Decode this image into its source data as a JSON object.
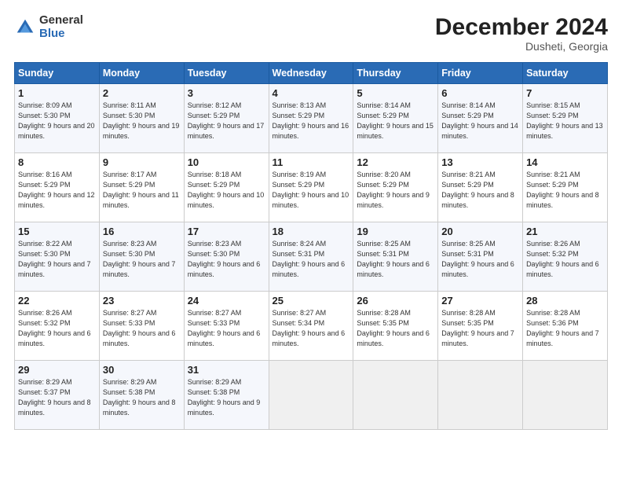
{
  "header": {
    "logo_general": "General",
    "logo_blue": "Blue",
    "month_title": "December 2024",
    "location": "Dusheti, Georgia"
  },
  "days_of_week": [
    "Sunday",
    "Monday",
    "Tuesday",
    "Wednesday",
    "Thursday",
    "Friday",
    "Saturday"
  ],
  "weeks": [
    [
      {
        "day": "1",
        "sunrise": "Sunrise: 8:09 AM",
        "sunset": "Sunset: 5:30 PM",
        "daylight": "Daylight: 9 hours and 20 minutes."
      },
      {
        "day": "2",
        "sunrise": "Sunrise: 8:11 AM",
        "sunset": "Sunset: 5:30 PM",
        "daylight": "Daylight: 9 hours and 19 minutes."
      },
      {
        "day": "3",
        "sunrise": "Sunrise: 8:12 AM",
        "sunset": "Sunset: 5:29 PM",
        "daylight": "Daylight: 9 hours and 17 minutes."
      },
      {
        "day": "4",
        "sunrise": "Sunrise: 8:13 AM",
        "sunset": "Sunset: 5:29 PM",
        "daylight": "Daylight: 9 hours and 16 minutes."
      },
      {
        "day": "5",
        "sunrise": "Sunrise: 8:14 AM",
        "sunset": "Sunset: 5:29 PM",
        "daylight": "Daylight: 9 hours and 15 minutes."
      },
      {
        "day": "6",
        "sunrise": "Sunrise: 8:14 AM",
        "sunset": "Sunset: 5:29 PM",
        "daylight": "Daylight: 9 hours and 14 minutes."
      },
      {
        "day": "7",
        "sunrise": "Sunrise: 8:15 AM",
        "sunset": "Sunset: 5:29 PM",
        "daylight": "Daylight: 9 hours and 13 minutes."
      }
    ],
    [
      {
        "day": "8",
        "sunrise": "Sunrise: 8:16 AM",
        "sunset": "Sunset: 5:29 PM",
        "daylight": "Daylight: 9 hours and 12 minutes."
      },
      {
        "day": "9",
        "sunrise": "Sunrise: 8:17 AM",
        "sunset": "Sunset: 5:29 PM",
        "daylight": "Daylight: 9 hours and 11 minutes."
      },
      {
        "day": "10",
        "sunrise": "Sunrise: 8:18 AM",
        "sunset": "Sunset: 5:29 PM",
        "daylight": "Daylight: 9 hours and 10 minutes."
      },
      {
        "day": "11",
        "sunrise": "Sunrise: 8:19 AM",
        "sunset": "Sunset: 5:29 PM",
        "daylight": "Daylight: 9 hours and 10 minutes."
      },
      {
        "day": "12",
        "sunrise": "Sunrise: 8:20 AM",
        "sunset": "Sunset: 5:29 PM",
        "daylight": "Daylight: 9 hours and 9 minutes."
      },
      {
        "day": "13",
        "sunrise": "Sunrise: 8:21 AM",
        "sunset": "Sunset: 5:29 PM",
        "daylight": "Daylight: 9 hours and 8 minutes."
      },
      {
        "day": "14",
        "sunrise": "Sunrise: 8:21 AM",
        "sunset": "Sunset: 5:29 PM",
        "daylight": "Daylight: 9 hours and 8 minutes."
      }
    ],
    [
      {
        "day": "15",
        "sunrise": "Sunrise: 8:22 AM",
        "sunset": "Sunset: 5:30 PM",
        "daylight": "Daylight: 9 hours and 7 minutes."
      },
      {
        "day": "16",
        "sunrise": "Sunrise: 8:23 AM",
        "sunset": "Sunset: 5:30 PM",
        "daylight": "Daylight: 9 hours and 7 minutes."
      },
      {
        "day": "17",
        "sunrise": "Sunrise: 8:23 AM",
        "sunset": "Sunset: 5:30 PM",
        "daylight": "Daylight: 9 hours and 6 minutes."
      },
      {
        "day": "18",
        "sunrise": "Sunrise: 8:24 AM",
        "sunset": "Sunset: 5:31 PM",
        "daylight": "Daylight: 9 hours and 6 minutes."
      },
      {
        "day": "19",
        "sunrise": "Sunrise: 8:25 AM",
        "sunset": "Sunset: 5:31 PM",
        "daylight": "Daylight: 9 hours and 6 minutes."
      },
      {
        "day": "20",
        "sunrise": "Sunrise: 8:25 AM",
        "sunset": "Sunset: 5:31 PM",
        "daylight": "Daylight: 9 hours and 6 minutes."
      },
      {
        "day": "21",
        "sunrise": "Sunrise: 8:26 AM",
        "sunset": "Sunset: 5:32 PM",
        "daylight": "Daylight: 9 hours and 6 minutes."
      }
    ],
    [
      {
        "day": "22",
        "sunrise": "Sunrise: 8:26 AM",
        "sunset": "Sunset: 5:32 PM",
        "daylight": "Daylight: 9 hours and 6 minutes."
      },
      {
        "day": "23",
        "sunrise": "Sunrise: 8:27 AM",
        "sunset": "Sunset: 5:33 PM",
        "daylight": "Daylight: 9 hours and 6 minutes."
      },
      {
        "day": "24",
        "sunrise": "Sunrise: 8:27 AM",
        "sunset": "Sunset: 5:33 PM",
        "daylight": "Daylight: 9 hours and 6 minutes."
      },
      {
        "day": "25",
        "sunrise": "Sunrise: 8:27 AM",
        "sunset": "Sunset: 5:34 PM",
        "daylight": "Daylight: 9 hours and 6 minutes."
      },
      {
        "day": "26",
        "sunrise": "Sunrise: 8:28 AM",
        "sunset": "Sunset: 5:35 PM",
        "daylight": "Daylight: 9 hours and 6 minutes."
      },
      {
        "day": "27",
        "sunrise": "Sunrise: 8:28 AM",
        "sunset": "Sunset: 5:35 PM",
        "daylight": "Daylight: 9 hours and 7 minutes."
      },
      {
        "day": "28",
        "sunrise": "Sunrise: 8:28 AM",
        "sunset": "Sunset: 5:36 PM",
        "daylight": "Daylight: 9 hours and 7 minutes."
      }
    ],
    [
      {
        "day": "29",
        "sunrise": "Sunrise: 8:29 AM",
        "sunset": "Sunset: 5:37 PM",
        "daylight": "Daylight: 9 hours and 8 minutes."
      },
      {
        "day": "30",
        "sunrise": "Sunrise: 8:29 AM",
        "sunset": "Sunset: 5:38 PM",
        "daylight": "Daylight: 9 hours and 8 minutes."
      },
      {
        "day": "31",
        "sunrise": "Sunrise: 8:29 AM",
        "sunset": "Sunset: 5:38 PM",
        "daylight": "Daylight: 9 hours and 9 minutes."
      },
      null,
      null,
      null,
      null
    ]
  ]
}
